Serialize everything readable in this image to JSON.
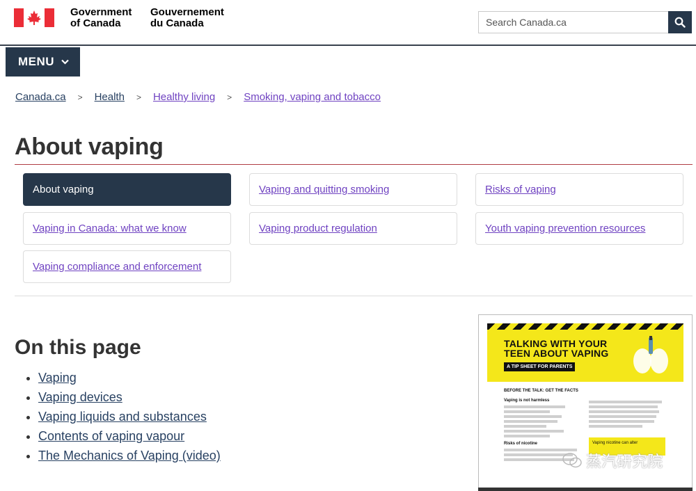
{
  "header": {
    "signature_en": [
      "Government",
      "of Canada"
    ],
    "signature_fr": [
      "Gouvernement",
      "du Canada"
    ],
    "search_placeholder": "Search Canada.ca",
    "colors": {
      "flag_red": "#eb2d37",
      "nav_dark": "#26374a"
    }
  },
  "menu": {
    "label": "MENU"
  },
  "breadcrumbs": [
    "Canada.ca",
    "Health",
    "Healthy living",
    "Smoking, vaping and tobacco"
  ],
  "page_title": "About vaping",
  "subnav": [
    "About vaping",
    "Vaping and quitting smoking",
    "Risks of vaping",
    "Vaping in Canada: what we know",
    "Vaping product regulation",
    "Youth vaping prevention resources",
    "Vaping compliance and enforcement"
  ],
  "toc": {
    "title": "On this page",
    "items": [
      "Vaping",
      "Vaping devices",
      "Vaping liquids and substances",
      "Contents of vaping vapour",
      "The Mechanics of Vaping (video)"
    ]
  },
  "tipsheet": {
    "title_lines": [
      "TALKING WITH YOUR",
      "TEEN ABOUT VAPING"
    ],
    "tag": "A TIP SHEET FOR PARENTS",
    "section_heading": "BEFORE THE TALK: GET THE FACTS",
    "sub1": "Vaping is not harmless",
    "sub2": "Risks of nicotine",
    "box_text": "Vaping nicotine can alter"
  },
  "watermark": {
    "text": "蒸汽研究院"
  }
}
